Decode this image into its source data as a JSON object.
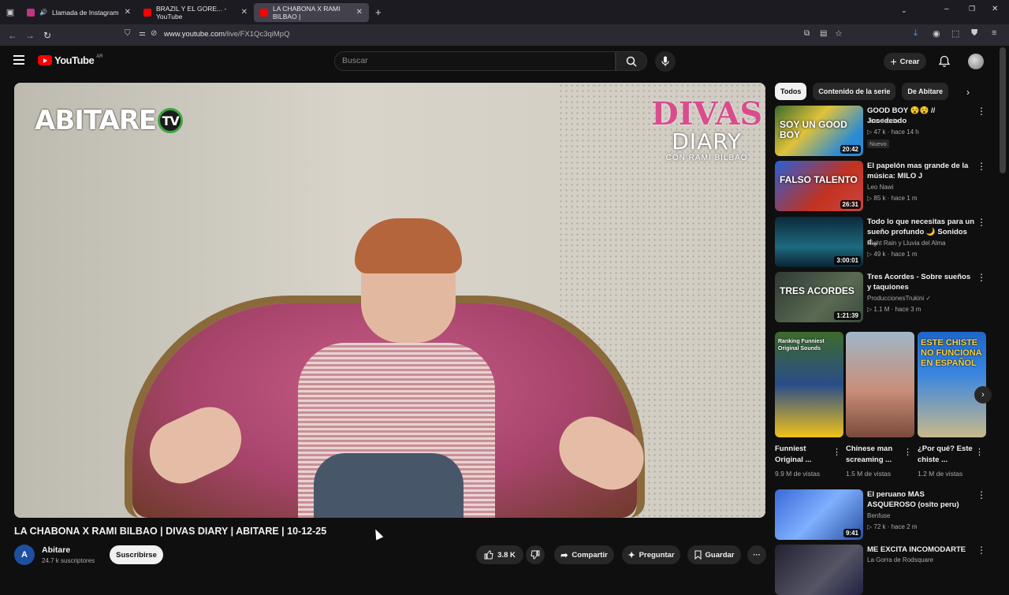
{
  "browser": {
    "tabs": [
      {
        "label": "Llamada de Instagram",
        "color": "#c13584"
      },
      {
        "label": "BRAZIL Y EL GORE... - YouTube",
        "color": "#ff0000"
      },
      {
        "label": "LA CHABONA X RAMI BILBAO |",
        "color": "#ff0000"
      }
    ],
    "url_host": "www.youtube.com",
    "url_path": "/live/FX1Qc3qiMpQ"
  },
  "header": {
    "logo_text": "YouTube",
    "logo_country": "AR",
    "search_placeholder": "Buscar",
    "create_label": "Crear"
  },
  "video": {
    "overlay_left": "ABITARE",
    "overlay_left_badge": "TV",
    "overlay_right_1": "DIVAS",
    "overlay_right_2": "DIARY",
    "overlay_right_3": "CON RAMI BILBAO",
    "title": "LA CHABONA X RAMI BILBAO | DIVAS DIARY | ABITARE | 10-12-25",
    "channel": "Abitare",
    "channel_initial": "A",
    "subscribers": "24.7 k suscriptores",
    "subscribe_label": "Suscribirse",
    "likes": "3.8 K",
    "share_label": "Compartir",
    "ask_label": "Preguntar",
    "save_label": "Guardar"
  },
  "sidebar": {
    "chips": [
      "Todos",
      "Contenido de la serie",
      "De Abitare"
    ],
    "recs": [
      {
        "title": "GOOD BOY 😵😵 // Josedeodo",
        "channel": "Josedeodo",
        "meta": "47 k · hace 14 h",
        "badge": "Nuevo",
        "duration": "20:42",
        "thumb": "linear-gradient(135deg,#3b6b2e,#e0c23a 40%,#2a8ad6 80%)",
        "thumb_text": "SOY UN GOOD BOY"
      },
      {
        "title": "El papelón mas grande de la música: MILO J",
        "channel": "Leo Nawi",
        "meta": "85 k · hace 1 m",
        "badge": "",
        "duration": "26:31",
        "thumb": "linear-gradient(135deg,#2a5fd6,#c2321f 60%,#c44)",
        "thumb_text": "FALSO TALENTO"
      },
      {
        "title": "Todo lo que necesitas para un sueño profundo 🌙 Sonidos d...",
        "channel": "Night Rain y Lluvia del Alma",
        "meta": "49 k · hace 1 m",
        "badge": "",
        "duration": "3:00:01",
        "thumb": "linear-gradient(180deg,#0b2a3a,#1d6a80 60%,#0a2230)",
        "thumb_text": ""
      },
      {
        "title": "Tres Acordes - Sobre sueños y taquiones",
        "channel": "ProduccionesTrukini ✓",
        "meta": "1.1 M · hace 3 m",
        "badge": "",
        "duration": "1:21:39",
        "thumb": "linear-gradient(135deg,#2e3a34,#5a6a52 60%,#3a4a3e)",
        "thumb_text": "TRES ACORDES"
      },
      {
        "title": "El peruano MAS ASQUEROSO (osito peru)",
        "channel": "Benfuse",
        "meta": "72 k · hace 2 m",
        "badge": "",
        "duration": "9:41",
        "thumb": "linear-gradient(135deg,#3a6ad6,#7fb0ff 50%,#2a4fa0)",
        "thumb_text": ""
      },
      {
        "title": "ME EXCITA INCOMODARTE",
        "channel": "La Gorra de Rodsquare",
        "meta": "",
        "badge": "",
        "duration": "",
        "thumb": "linear-gradient(135deg,#223,#556 60%,#224)",
        "thumb_text": ""
      }
    ],
    "shorts": [
      {
        "title": "Funniest Original ...",
        "views": "9.9 M de vistas",
        "thumb": "linear-gradient(180deg,#3d6a2a,#2a4d8a 50%,#f1c21a)",
        "thumb_text": "Ranking Funniest Original Sounds"
      },
      {
        "title": "Chinese man screaming ...",
        "views": "1.5 M de vistas",
        "thumb": "linear-gradient(180deg,#9fb6c8,#c98f7a 55%,#7a4a3a)",
        "thumb_text": ""
      },
      {
        "title": "¿Por qué? Este chiste ...",
        "views": "1.2 M de vistas",
        "thumb": "linear-gradient(180deg,#1e66c9,#3a86e0 40%,#c8b98a)",
        "thumb_text": "ESTE CHISTE NO FUNCIONA EN ESPAÑOL"
      }
    ]
  }
}
